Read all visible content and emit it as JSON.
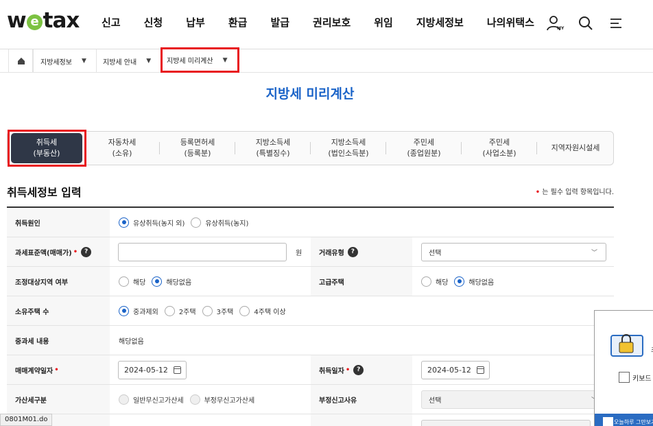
{
  "brand": {
    "logo_pre": "w",
    "logo_e": "e",
    "logo_post": "tax"
  },
  "nav": [
    "신고",
    "신청",
    "납부",
    "환급",
    "발급",
    "권리보호",
    "위임",
    "지방세정보",
    "나의위택스"
  ],
  "header_icons": {
    "my": "user-my-icon",
    "search": "search-icon",
    "menu": "hamburger-menu-icon",
    "my_label": "MY"
  },
  "breadcrumb": [
    {
      "label": "지방세정보",
      "arrow": "▼"
    },
    {
      "label": "지방세 안내",
      "arrow": "▼"
    },
    {
      "label": "지방세 미리계산",
      "arrow": "▼"
    }
  ],
  "page_title": "지방세 미리계산",
  "tabs": [
    {
      "line1": "취득세",
      "line2": "(부동산)",
      "active": true
    },
    {
      "line1": "자동차세",
      "line2": "(소유)"
    },
    {
      "line1": "등록면허세",
      "line2": "(등록분)"
    },
    {
      "line1": "지방소득세",
      "line2": "(특별징수)"
    },
    {
      "line1": "지방소득세",
      "line2": "(법인소득분)"
    },
    {
      "line1": "주민세",
      "line2": "(종업원분)"
    },
    {
      "line1": "주민세",
      "line2": "(사업소분)"
    },
    {
      "line1": "지역자원시설세",
      "line2": ""
    }
  ],
  "section_title": "취득세정보 입력",
  "required_note": {
    "mark": "•",
    "text": "는 필수 입력 항목입니다."
  },
  "form": {
    "cause": {
      "label": "취득원인",
      "opt1": "유상취득(농지 외)",
      "opt2": "유상취득(농지)"
    },
    "tax_base": {
      "label": "과세표준액(매매가)",
      "req": "•",
      "help": "?",
      "unit": "원",
      "value": ""
    },
    "deal_type": {
      "label": "거래유형",
      "help": "?",
      "value": "선택",
      "chev": "﹀"
    },
    "adjust_area": {
      "label": "조정대상지역 여부",
      "opt1": "해당",
      "opt2": "해당없음"
    },
    "luxury": {
      "label": "고급주택",
      "opt1": "해당",
      "opt2": "해당없음"
    },
    "houses": {
      "label": "소유주택 수",
      "opt1": "중과제외",
      "opt2": "2주택",
      "opt3": "3주택",
      "opt4": "4주택 이상"
    },
    "heavy": {
      "label": "중과세 내용",
      "value": "해당없음"
    },
    "contract_date": {
      "label": "매매계약일자",
      "req": "•",
      "value": "2024-05-12"
    },
    "acq_date": {
      "label": "취득일자",
      "req": "•",
      "help": "?",
      "value": "2024-05-12"
    },
    "penalty": {
      "label": "가산세구분",
      "opt1": "일반무신고가산세",
      "opt2": "부정무신고가산세"
    },
    "penalty_reason": {
      "label": "부정신고사유",
      "value": "선택",
      "chev": "﹀"
    }
  },
  "popup": {
    "checkbox_label": "키보드",
    "bar_text": "오늘하루 그만보기",
    "side_text": "초"
  },
  "status_url": "0801M01.do"
}
